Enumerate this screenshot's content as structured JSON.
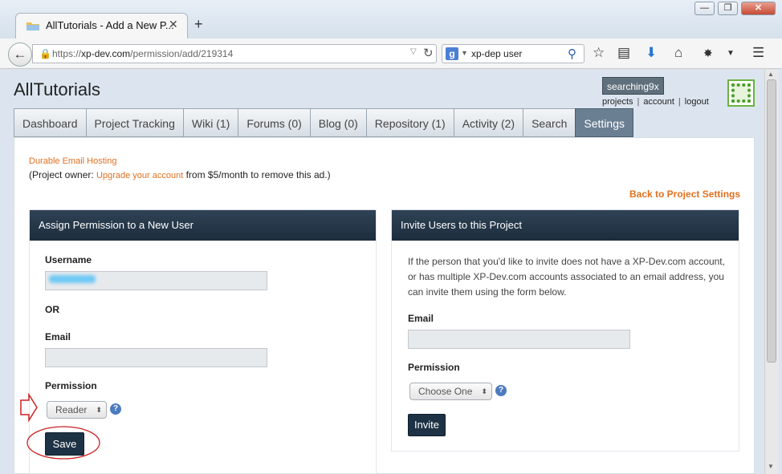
{
  "browser": {
    "tab_title": "AllTutorials - Add a New P...",
    "tab_close": "✕",
    "new_tab": "+",
    "window_buttons": {
      "minimize": "—",
      "maximize": "❐",
      "close": "✕"
    },
    "url_scheme": "https://",
    "url_host": "xp-dev.com",
    "url_path": "/permission/add/219314",
    "search_engine_icon": "google-icon",
    "search_value": "xp-dep user",
    "toolbar_icons": [
      "back-arrow-icon",
      "lock-icon",
      "reload-icon",
      "search-icon",
      "bookmark-star-icon",
      "reading-list-icon",
      "download-icon",
      "home-icon",
      "addon-icon",
      "dropdown-icon",
      "menu-icon"
    ]
  },
  "site": {
    "title": "AllTutorials",
    "username_badge": "searching9x",
    "user_links": [
      "projects",
      "account",
      "logout"
    ]
  },
  "nav": {
    "tabs": [
      {
        "label": "Dashboard",
        "active": false
      },
      {
        "label": "Project Tracking",
        "active": false
      },
      {
        "label": "Wiki (1)",
        "active": false
      },
      {
        "label": "Forums (0)",
        "active": false
      },
      {
        "label": "Blog (0)",
        "active": false
      },
      {
        "label": "Repository (1)",
        "active": false
      },
      {
        "label": "Activity (2)",
        "active": false
      },
      {
        "label": "Search",
        "active": false
      },
      {
        "label": "Settings",
        "active": true
      }
    ]
  },
  "ad": {
    "link": "Durable Email Hosting",
    "text_before": "(Project owner: ",
    "upgrade_link": "Upgrade your account",
    "text_after": " from $5/month to remove this ad.)"
  },
  "back_link": "Back to Project Settings",
  "assign_panel": {
    "heading": "Assign Permission to a New User",
    "username_label": "Username",
    "or_label": "OR",
    "email_label": "Email",
    "permission_label": "Permission",
    "permission_selected": "Reader",
    "save_button": "Save"
  },
  "invite_panel": {
    "heading": "Invite Users to this Project",
    "description": "If the person that you'd like to invite does not have a XP-Dev.com account, or has multiple XP-Dev.com accounts associated to an email address, you can invite them using the form below.",
    "email_label": "Email",
    "permission_label": "Permission",
    "permission_selected": "Choose One",
    "invite_button": "Invite"
  },
  "colors": {
    "accent_orange": "#e0701f",
    "panel_header": "#1c2d3d",
    "active_tab": "#6b7f92",
    "annotation_red": "#cc2222"
  }
}
